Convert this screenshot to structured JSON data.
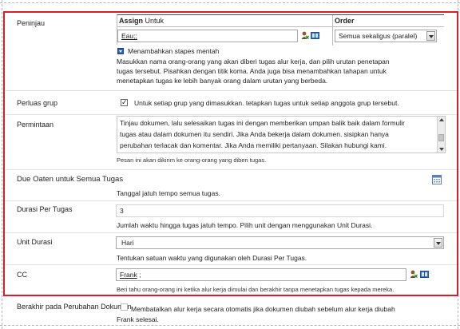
{
  "reviewers": {
    "label": "Peninjau",
    "assign_header_bold": "Assign",
    "assign_header_rest": " Untuk",
    "order_header": "Order",
    "assign_value": "Eau;;",
    "order_value": "Semua sekaligus (paralel)",
    "add_stages_link": "Menambahkan stapes mentah",
    "help_line1": "Masukkan nama orang-orang yang akan diberi tugas alur kerja, dan pilih urutan penetapan",
    "help_line2": "tugas tersebut. Pisahkan dengan titik koma. Anda juga bisa menambahkan tahapan untuk",
    "help_line3": "menetapkan tugas ke lebih banyak orang dalam urutan yang berbeda."
  },
  "expand_groups": {
    "label": "Perluas grup",
    "checkbox_text": "Untuk setiap grup yang dimasukkan. tetapkan tugas untuk setiap anggota grup tersebut.",
    "checked": true
  },
  "request": {
    "label": "Permintaan",
    "line1": "Tinjau dokumen, lalu selesaikan tugas ini dengan memberikan umpan balik baik dalam formulir",
    "line2": "tugas atau dalam dokumen itu sendiri. Jika Anda bekerja dalam dokumen. sisipkan hanya",
    "line3": "perubahan terlacak dan komentar. Jika Anda memiliki pertanyaan. Silakan hubungi kami.",
    "help": "Pesan ini akan dikirim ke orang-orang yang diberi tugas."
  },
  "due_date": {
    "label": "Due Oaten untuk Semua Tugas",
    "help": "Tanggal jatuh tempo semua tugas."
  },
  "duration": {
    "label": "Durasi Per Tugas",
    "value": "3",
    "help": "Jumlah waktu hingga tugas jatuh tempo. Pilih unit dengan menggunakan Unit Durasi."
  },
  "duration_unit": {
    "label": "Unit Durasi",
    "value": "Hari",
    "help": "Tentukan satuan waktu yang digunakan oleh Durasi Per Tugas."
  },
  "cc": {
    "label": "CC",
    "value": "Frank",
    "value_suffix": " ;",
    "help": "Beri tahu orang-orang ini ketika alur kerja dimulai dan berakhir tanpa menetapkan tugas kepada mereka."
  },
  "end_on_change": {
    "label": "Berakhir pada Perubahan Dokumen",
    "line1": "Membatalkan alur kerja secara otomatis jika dokumen diubah sebelum alur kerja diubah",
    "line2": "Frank selesai.",
    "checked": false
  },
  "colors": {
    "highlight_border": "#d81e2a",
    "link_blue": "#2b63c4"
  },
  "icons": {
    "people_picker": "check-names-icon",
    "browse": "address-book-icon",
    "calendar": "calendar-icon",
    "expander": "expand-arrow-icon"
  }
}
